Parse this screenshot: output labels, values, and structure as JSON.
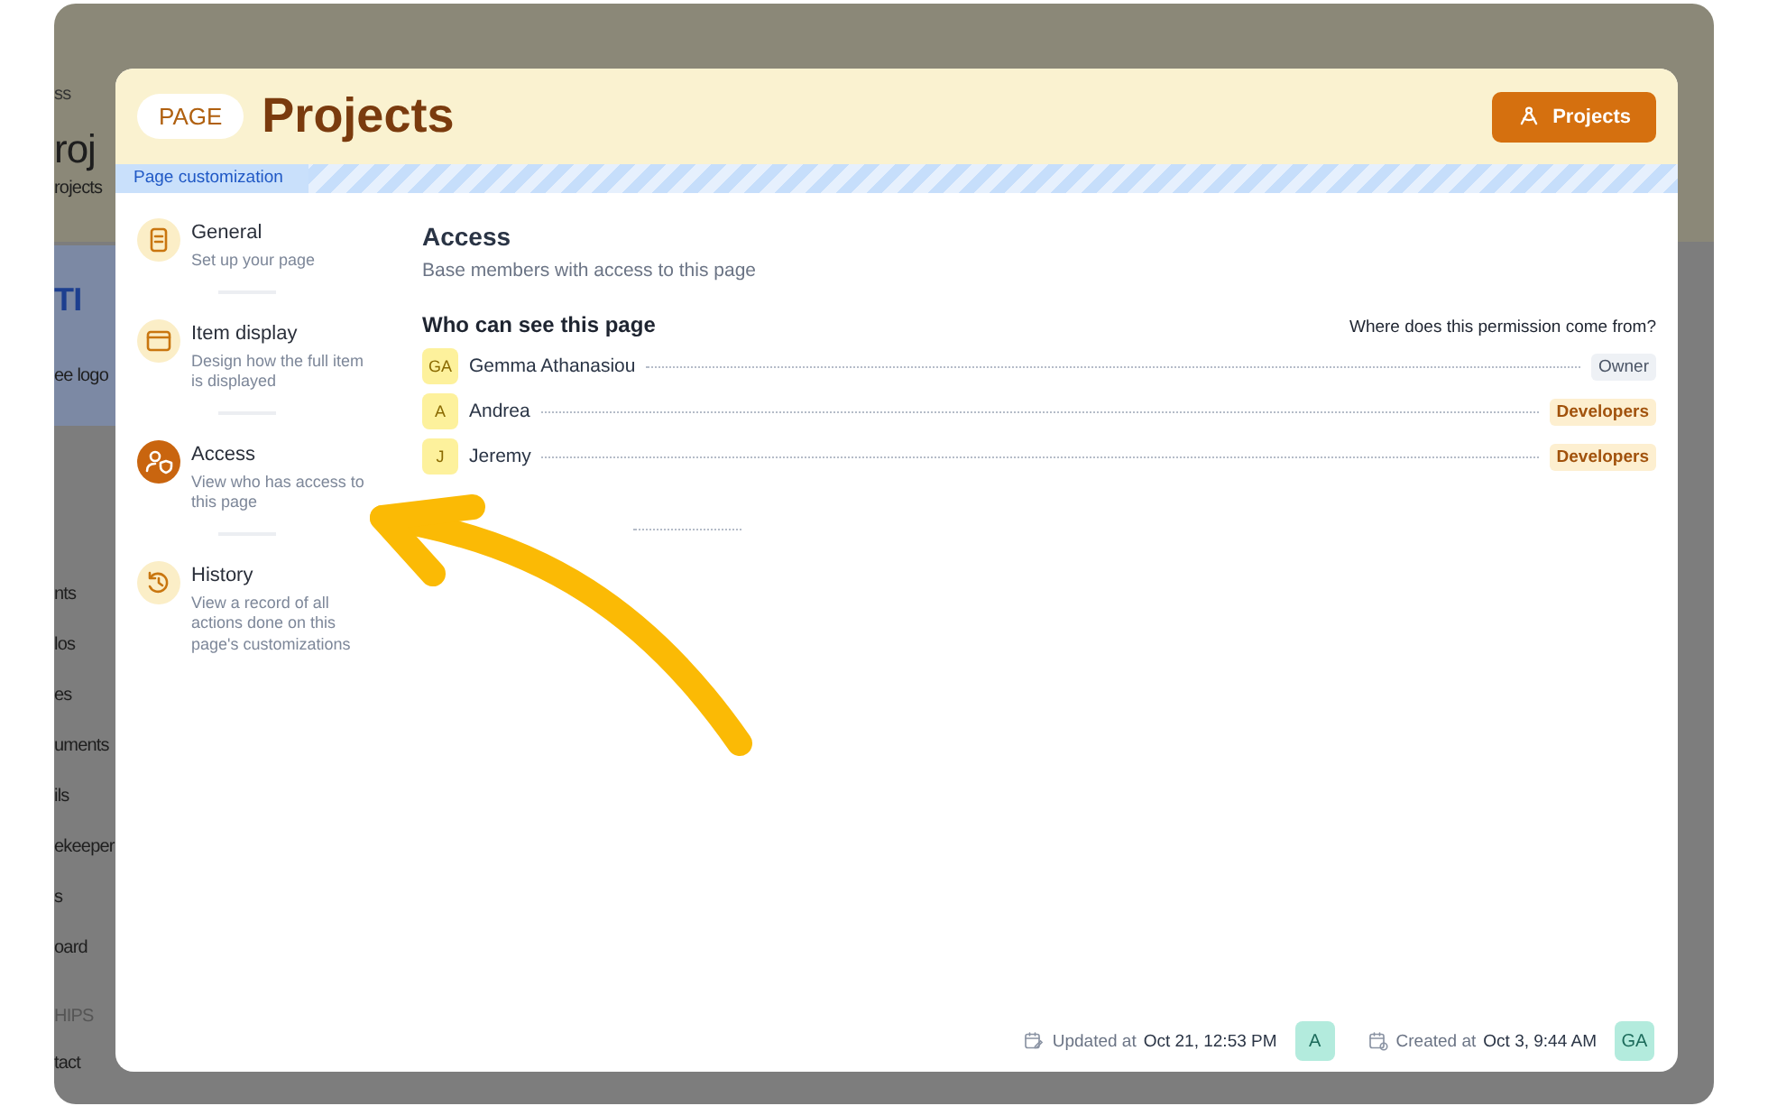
{
  "backdrop": {
    "fragments": [
      {
        "kind": "crumb",
        "text": "ss"
      },
      {
        "kind": "title",
        "text": "roj"
      },
      {
        "kind": "sub",
        "text": "rojects"
      },
      {
        "kind": "card",
        "text": "TI"
      },
      {
        "kind": "label",
        "text": "ee logo"
      },
      {
        "kind": "nav",
        "text": "nts"
      },
      {
        "kind": "nav",
        "text": "los"
      },
      {
        "kind": "nav",
        "text": "es"
      },
      {
        "kind": "nav",
        "text": "uments"
      },
      {
        "kind": "nav",
        "text": "ils"
      },
      {
        "kind": "nav",
        "text": "ekeeper"
      },
      {
        "kind": "nav",
        "text": "s"
      },
      {
        "kind": "nav",
        "text": "oard"
      },
      {
        "kind": "section",
        "text": "HIPS"
      },
      {
        "kind": "nav",
        "text": "tact"
      }
    ]
  },
  "modal": {
    "badge": "PAGE",
    "title": "Projects",
    "button": "Projects",
    "banner": "Page customization"
  },
  "sidebar": {
    "items": [
      {
        "kind": "general",
        "title": "General",
        "description": "Set up your page",
        "selected": false
      },
      {
        "kind": "display",
        "title": "Item display",
        "description": "Design how the full item is displayed",
        "selected": false
      },
      {
        "kind": "access",
        "title": "Access",
        "description": "View who has access to this page",
        "selected": true
      },
      {
        "kind": "history",
        "title": "History",
        "description": "View a record of all actions done on this page's customizations",
        "selected": false
      }
    ]
  },
  "content": {
    "title": "Access",
    "subtitle": "Base members with access to this page",
    "section_title": "Who can see this page",
    "section_link": "Where does this permission come from?",
    "members": [
      {
        "initials": "GA",
        "name": "Gemma Athanasiou",
        "role": "Owner",
        "kind": "owner"
      },
      {
        "initials": "A",
        "name": "Andrea",
        "role": "Developers",
        "kind": "group"
      },
      {
        "initials": "J",
        "name": "Jeremy",
        "role": "Developers",
        "kind": "group"
      }
    ]
  },
  "footer": {
    "items": [
      {
        "kind": "updated",
        "label": "Updated at",
        "value": "Oct 21, 12:53 PM",
        "avatar": "A"
      },
      {
        "kind": "created",
        "label": "Created at",
        "value": "Oct 3, 9:44 AM",
        "avatar": "GA"
      }
    ]
  }
}
